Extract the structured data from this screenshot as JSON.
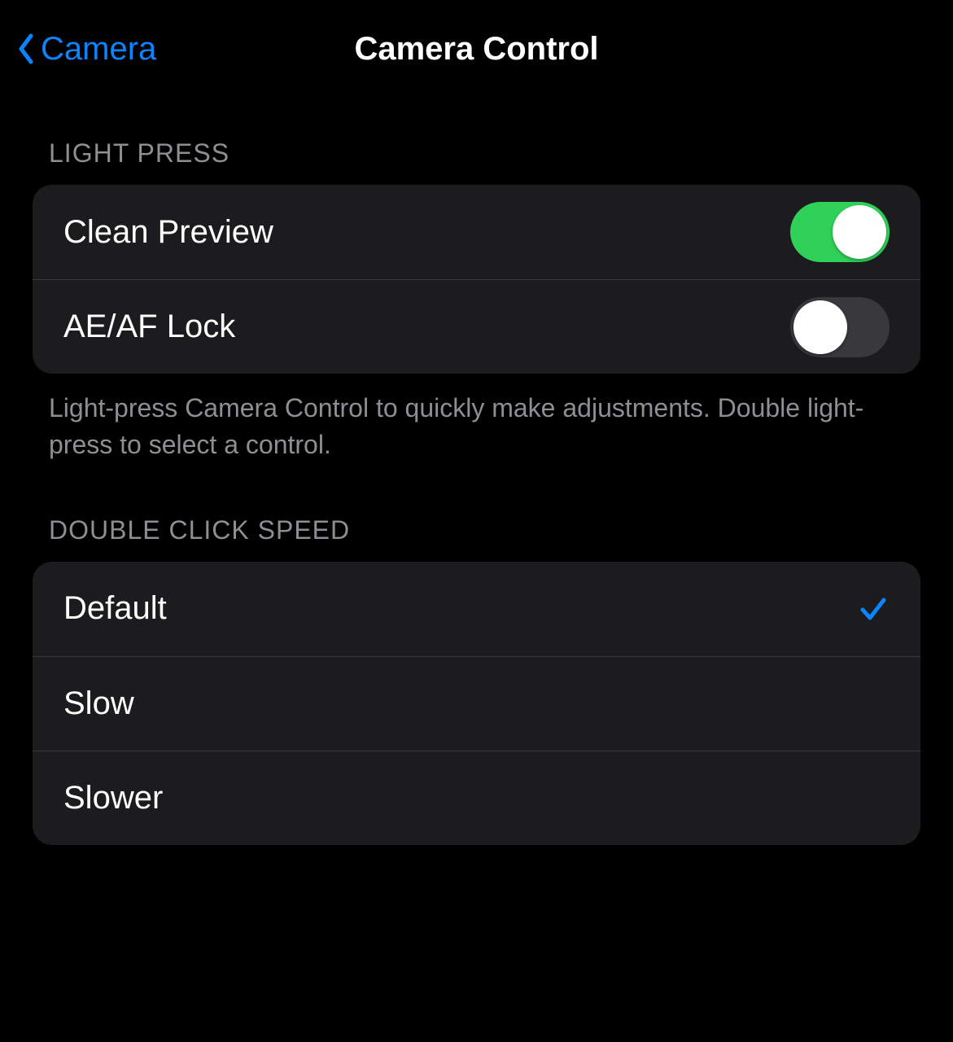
{
  "nav": {
    "back_label": "Camera",
    "title": "Camera Control"
  },
  "sections": {
    "light_press": {
      "header": "LIGHT PRESS",
      "rows": [
        {
          "label": "Clean Preview",
          "toggle": true
        },
        {
          "label": "AE/AF Lock",
          "toggle": false
        }
      ],
      "footer": "Light-press Camera Control to quickly make adjustments. Double light-press to select a control."
    },
    "double_click_speed": {
      "header": "DOUBLE CLICK SPEED",
      "options": [
        {
          "label": "Default",
          "selected": true
        },
        {
          "label": "Slow",
          "selected": false
        },
        {
          "label": "Slower",
          "selected": false
        }
      ]
    }
  },
  "colors": {
    "accent": "#0a84ff",
    "toggle_on": "#30d158"
  }
}
